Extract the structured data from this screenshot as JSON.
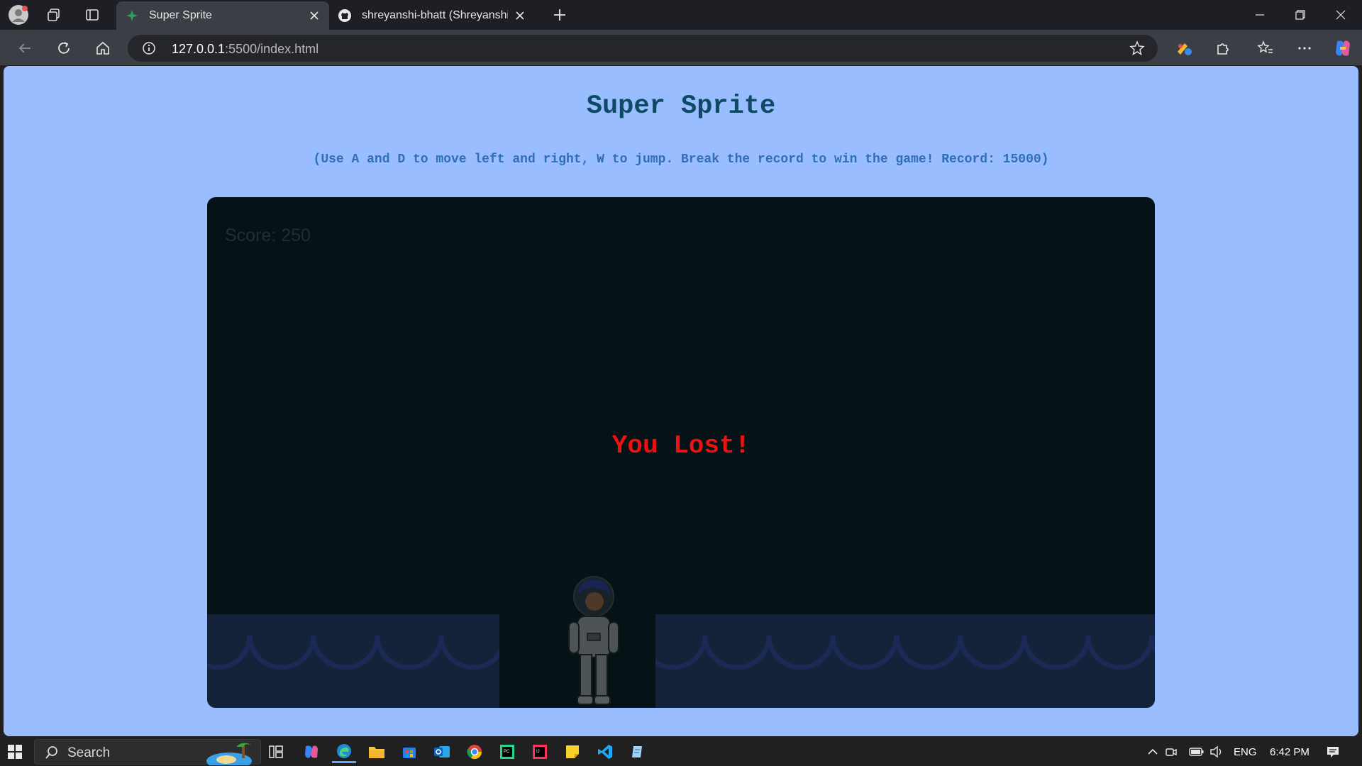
{
  "browser": {
    "tabs": [
      {
        "title": "Super Sprite",
        "active": true
      },
      {
        "title": "shreyanshi-bhatt (Shreyanshi Bhat",
        "active": false
      }
    ],
    "url_host": "127.0.0.1",
    "url_rest": ":5500/index.html"
  },
  "page": {
    "title": "Super Sprite",
    "instructions": "(Use A and D to move left and right, W to jump. Break the record to win the game! Record: 15000)"
  },
  "game": {
    "score_label": "Score: ",
    "score_value": "250",
    "status_message": "You Lost!",
    "colors": {
      "background": "#051216",
      "ground": "#14223a",
      "lost_text": "#ee1111"
    }
  },
  "taskbar": {
    "search_placeholder": "Search",
    "language": "ENG",
    "time": "6:42 PM",
    "pinned_apps": [
      "copilot-icon",
      "edge-icon",
      "file-explorer-icon",
      "store-icon",
      "outlook-icon",
      "chrome-icon",
      "pycharm-icon",
      "intellij-icon",
      "sticky-notes-icon",
      "vscode-icon",
      "notepad-icon"
    ]
  }
}
